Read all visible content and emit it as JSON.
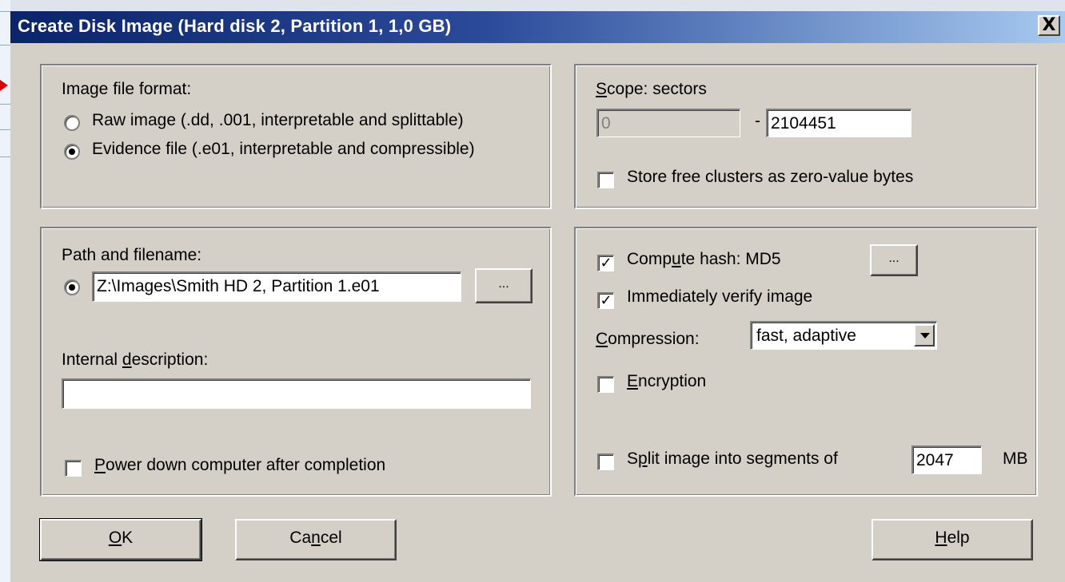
{
  "window": {
    "title": "Create Disk Image (Hard disk 2, Partition 1, 1,0 GB)",
    "close_glyph": "X"
  },
  "format_group": {
    "label": "Image file format:",
    "options": [
      {
        "label": "Raw image (.dd, .001, interpretable and splittable)",
        "selected": false
      },
      {
        "label": "Evidence file (.e01, interpretable and compressible)",
        "selected": true
      }
    ]
  },
  "scope_group": {
    "label_prefix": "S",
    "label_rest": "cope: sectors",
    "start_sector": "0",
    "separator": "-",
    "end_sector": "2104451",
    "free_clusters_label": "Store free clusters as zero-value bytes",
    "free_clusters_checked": false
  },
  "path_group": {
    "label": "Path and filename:",
    "path_value": "Z:\\Images\\Smith HD 2, Partition 1.e01",
    "browse_label": "...",
    "desc_label_pre": "Internal ",
    "desc_label_u": "d",
    "desc_label_post": "escription:",
    "desc_value": "",
    "power_label_u": "P",
    "power_label_rest": "ower down computer after completion",
    "power_checked": false
  },
  "options_group": {
    "hash_label_pre": "Comp",
    "hash_label_u": "u",
    "hash_label_post": "te hash: MD5",
    "hash_checked": true,
    "hash_button": "...",
    "verify_label": "Immediately verify image",
    "verify_checked": true,
    "compression_label_u": "C",
    "compression_label_rest": "ompression:",
    "compression_value": "fast, adaptive",
    "encryption_label_u": "E",
    "encryption_label_rest": "ncryption",
    "encryption_checked": false,
    "split_label_pre": "S",
    "split_label_u": "p",
    "split_label_post": "lit image into segments of",
    "split_checked": false,
    "split_value": "2047",
    "split_unit": "MB"
  },
  "buttons": {
    "ok_u": "O",
    "ok_rest": "K",
    "cancel_pre": "Ca",
    "cancel_u": "n",
    "cancel_post": "cel",
    "help_u": "H",
    "help_rest": "elp"
  },
  "colors": {
    "titlebar_start": "#0a246a",
    "titlebar_end": "#a6caf0",
    "dialog_face": "#d4d0c8"
  }
}
